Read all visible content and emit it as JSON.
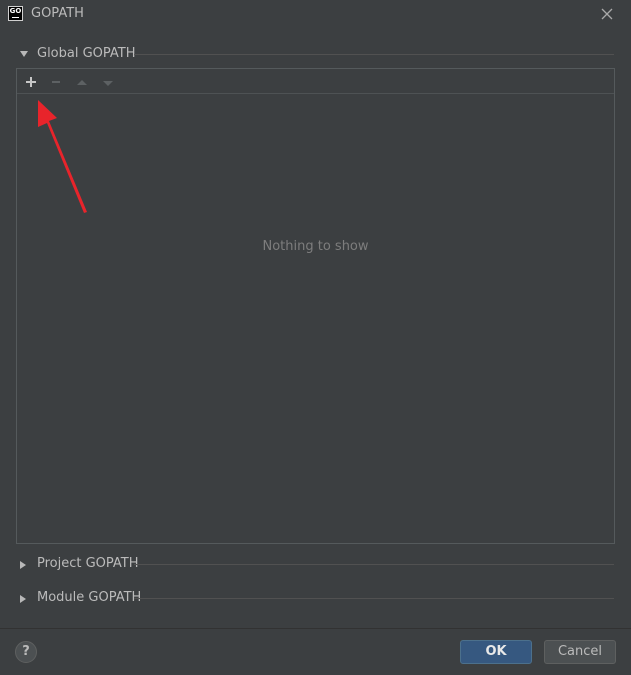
{
  "window": {
    "app_icon_text": "GO",
    "title": "GOPATH",
    "close_icon": "close-icon"
  },
  "sections": {
    "global": {
      "label": "Global GOPATH",
      "expanded": true
    },
    "project": {
      "label": "Project GOPATH",
      "expanded": false
    },
    "module": {
      "label": "Module GOPATH",
      "expanded": false
    }
  },
  "toolbar": {
    "add_icon": "plus-icon",
    "remove_icon": "minus-icon",
    "move_up_icon": "arrow-up-icon",
    "move_down_icon": "arrow-down-icon"
  },
  "list": {
    "empty_text": "Nothing to show",
    "items": []
  },
  "footer": {
    "help_label": "?",
    "ok_label": "OK",
    "cancel_label": "Cancel"
  },
  "colors": {
    "background": "#3c3f41",
    "primary_button": "#365880",
    "annotation_arrow": "#e8242b"
  }
}
